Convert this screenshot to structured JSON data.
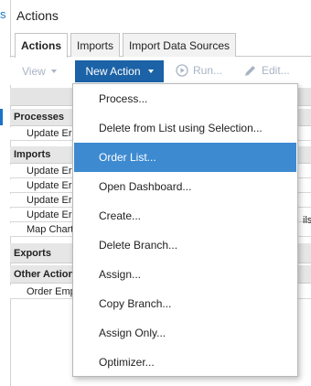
{
  "window": {
    "title": "Actions",
    "edge_glyph": "s"
  },
  "tabs": [
    {
      "label": "Actions",
      "active": true
    },
    {
      "label": "Imports",
      "active": false
    },
    {
      "label": "Import Data Sources",
      "active": false
    }
  ],
  "toolbar": {
    "view_label": "View",
    "new_action_label": "New Action",
    "run_label": "Run...",
    "edit_label": "Edit..."
  },
  "tree": {
    "groups": [
      {
        "label": "Processes",
        "items": [
          "Update Er"
        ]
      },
      {
        "label": "Imports",
        "items": [
          "Update Er",
          "Update Er",
          "Update Er",
          "Update Er",
          "Map Chart"
        ]
      },
      {
        "label": "Exports",
        "items": []
      },
      {
        "label": "Other Action",
        "items": [
          "Order Emp"
        ]
      }
    ],
    "right_clip_text": "ils"
  },
  "menu": {
    "items": [
      {
        "label": "Process...",
        "selected": false
      },
      {
        "label": "Delete from List using Selection...",
        "selected": false
      },
      {
        "label": "Order List...",
        "selected": true
      },
      {
        "label": "Open Dashboard...",
        "selected": false
      },
      {
        "label": "Create...",
        "selected": false
      },
      {
        "label": "Delete Branch...",
        "selected": false
      },
      {
        "label": "Assign...",
        "selected": false
      },
      {
        "label": "Copy Branch...",
        "selected": false
      },
      {
        "label": "Assign Only...",
        "selected": false
      },
      {
        "label": "Optimizer...",
        "selected": false
      }
    ]
  },
  "colors": {
    "accent": "#1c62a6",
    "selection": "#3d8ad1",
    "disabled_text": "#a8b4c4",
    "group_bg": "#e6e6e6"
  }
}
